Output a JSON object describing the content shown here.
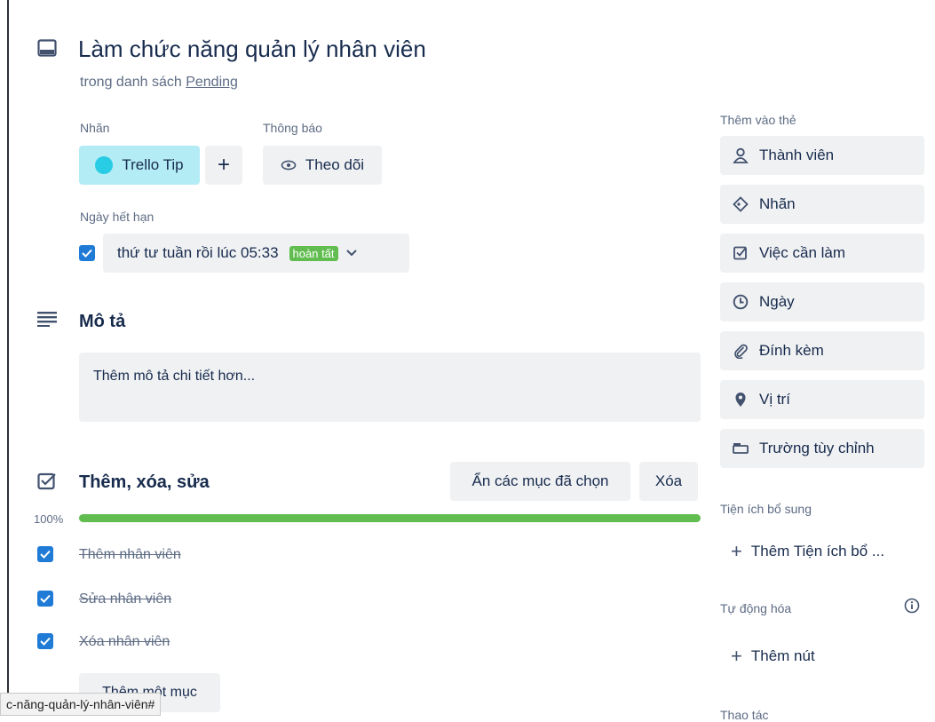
{
  "card": {
    "title": "Làm chức năng quản lý nhân viên",
    "list_prefix": "trong danh sách",
    "list_name": "Pending"
  },
  "labels": {
    "heading": "Nhãn",
    "chip": "Trello Tip",
    "chip_color": "#29cce5",
    "add": "+"
  },
  "notifications": {
    "heading": "Thông báo",
    "watch": "Theo dõi"
  },
  "due": {
    "heading": "Ngày hết hạn",
    "text": "thứ tư tuần rồi lúc 05:33",
    "badge": "hoàn tất"
  },
  "description": {
    "heading": "Mô tả",
    "placeholder": "Thêm mô tả chi tiết hơn..."
  },
  "checklist": {
    "title": "Thêm, xóa, sửa",
    "hide_checked": "Ẩn các mục đã chọn",
    "delete": "Xóa",
    "percent": "100%",
    "progress": 1.0,
    "items": [
      "Thêm nhân viên",
      "Sửa nhân viên",
      "Xóa nhân viên"
    ],
    "add_item": "Thêm một mục"
  },
  "sidebar": {
    "add_to_card": "Thêm vào thẻ",
    "buttons": [
      "Thành viên",
      "Nhãn",
      "Việc cần làm",
      "Ngày",
      "Đính kèm",
      "Vị trí",
      "Trường tùy chỉnh"
    ],
    "powerups_heading": "Tiện ích bổ sung",
    "add_powerup": "Thêm Tiện ích bổ ...",
    "automation_heading": "Tự động hóa",
    "add_button": "Thêm nút",
    "actions_heading": "Thao tác"
  },
  "status_bar": {
    "url": "c-năng-quản-lý-nhân-viên#"
  }
}
